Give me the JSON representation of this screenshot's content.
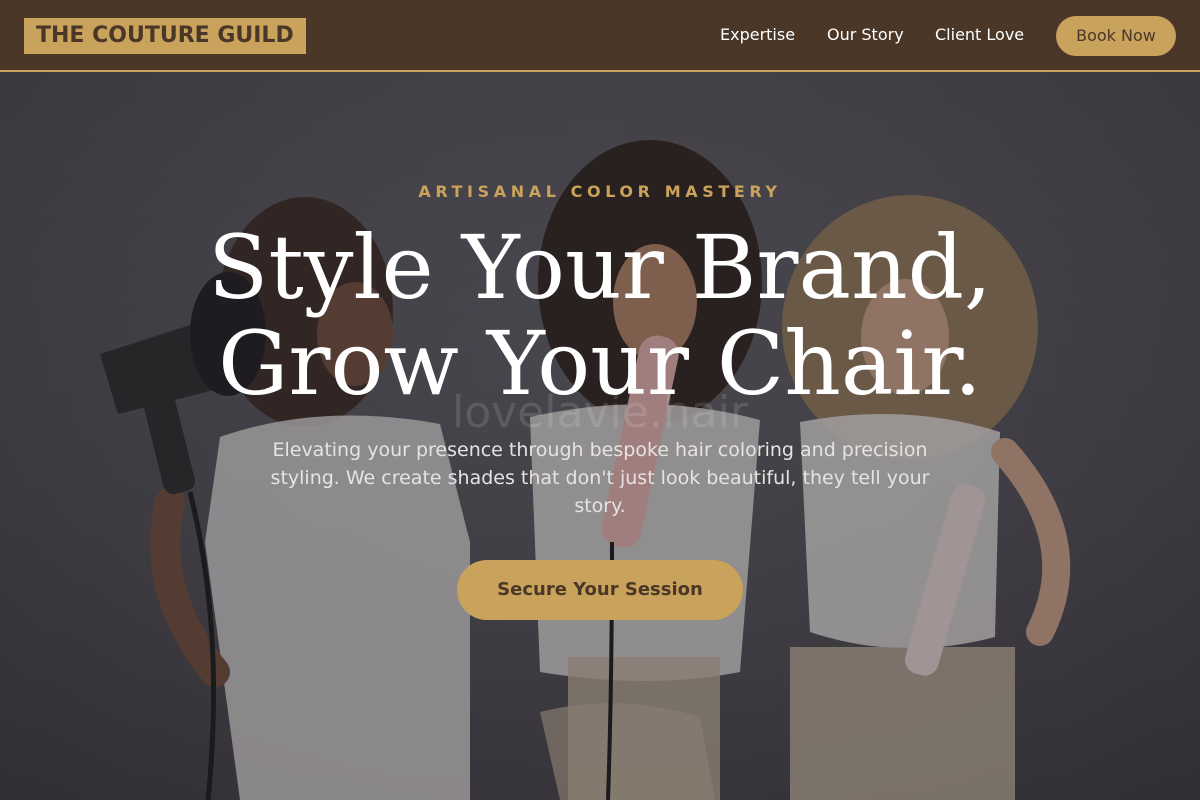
{
  "brand": {
    "logo_text": "THE COUTURE GUILD"
  },
  "nav": {
    "links": [
      "Expertise",
      "Our Story",
      "Client Love"
    ],
    "cta_label": "Book Now"
  },
  "hero": {
    "eyebrow": "ARTISANAL COLOR MASTERY",
    "headline_line1": "Style Your Brand,",
    "headline_line2": "Grow Your Chair.",
    "subtitle": "Elevating your presence through bespoke hair coloring and precision styling. We create shades that don't just look beautiful, they tell your story.",
    "cta_label": "Secure Your Session",
    "watermark": "lovelavie.hair"
  },
  "colors": {
    "header_bg": "#4a3728",
    "accent_gold": "#c9a25c",
    "text_light": "#ffffff"
  }
}
